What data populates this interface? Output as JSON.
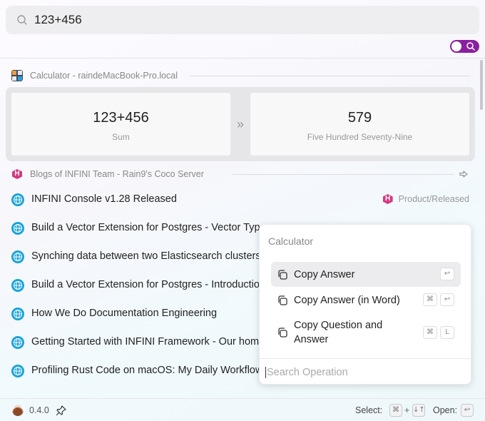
{
  "search": {
    "query": "123+456"
  },
  "calculator_section": {
    "header": "Calculator - raindeMacBook-Pro.local",
    "question": "123+456",
    "question_label": "Sum",
    "answer": "579",
    "answer_label": "Five Hundred Seventy-Nine"
  },
  "blog_section": {
    "header": "Blogs of INFINI Team - Rain9's Coco Server",
    "badge_letter": "H",
    "items": [
      {
        "title": "INFINI Console v1.28 Released",
        "tag": "Product/Released"
      },
      {
        "title": "Build a Vector Extension for Postgres - Vector Type"
      },
      {
        "title": "Synching data between two Elasticsearch clusters"
      },
      {
        "title": "Build a Vector Extension for Postgres - Introduction"
      },
      {
        "title": "How We Do Documentation Engineering"
      },
      {
        "title": "Getting Started with INFINI Framework - Our home"
      },
      {
        "title": "Profiling Rust Code on macOS: My Daily Workflow"
      }
    ]
  },
  "popup": {
    "title": "Calculator",
    "operations": [
      {
        "label": "Copy Answer",
        "keys": [
          "↩"
        ]
      },
      {
        "label": "Copy Answer (in Word)",
        "keys": [
          "⌘",
          "↩"
        ]
      },
      {
        "label": "Copy Question and Answer",
        "line1": "Copy Question and",
        "line2": "Answer",
        "keys": [
          "⌘",
          "L"
        ]
      }
    ],
    "search_placeholder": "Search Operation"
  },
  "footer": {
    "version": "0.4.0",
    "select_label": "Select:",
    "select_keys": [
      "⌘",
      "+",
      "↓↑"
    ],
    "open_label": "Open:",
    "open_key": "↩"
  },
  "colors": {
    "accent": "#8b1fa0",
    "badge": "#d6387f",
    "globe": "#1aa3d9"
  },
  "icons": {
    "search": "search-icon",
    "toggle": "search-mode-toggle",
    "calculator": "calculator-icon",
    "globe": "globe-icon",
    "copy": "copy-icon",
    "pin": "pin-icon",
    "arrow": "arrow-right-icon"
  }
}
